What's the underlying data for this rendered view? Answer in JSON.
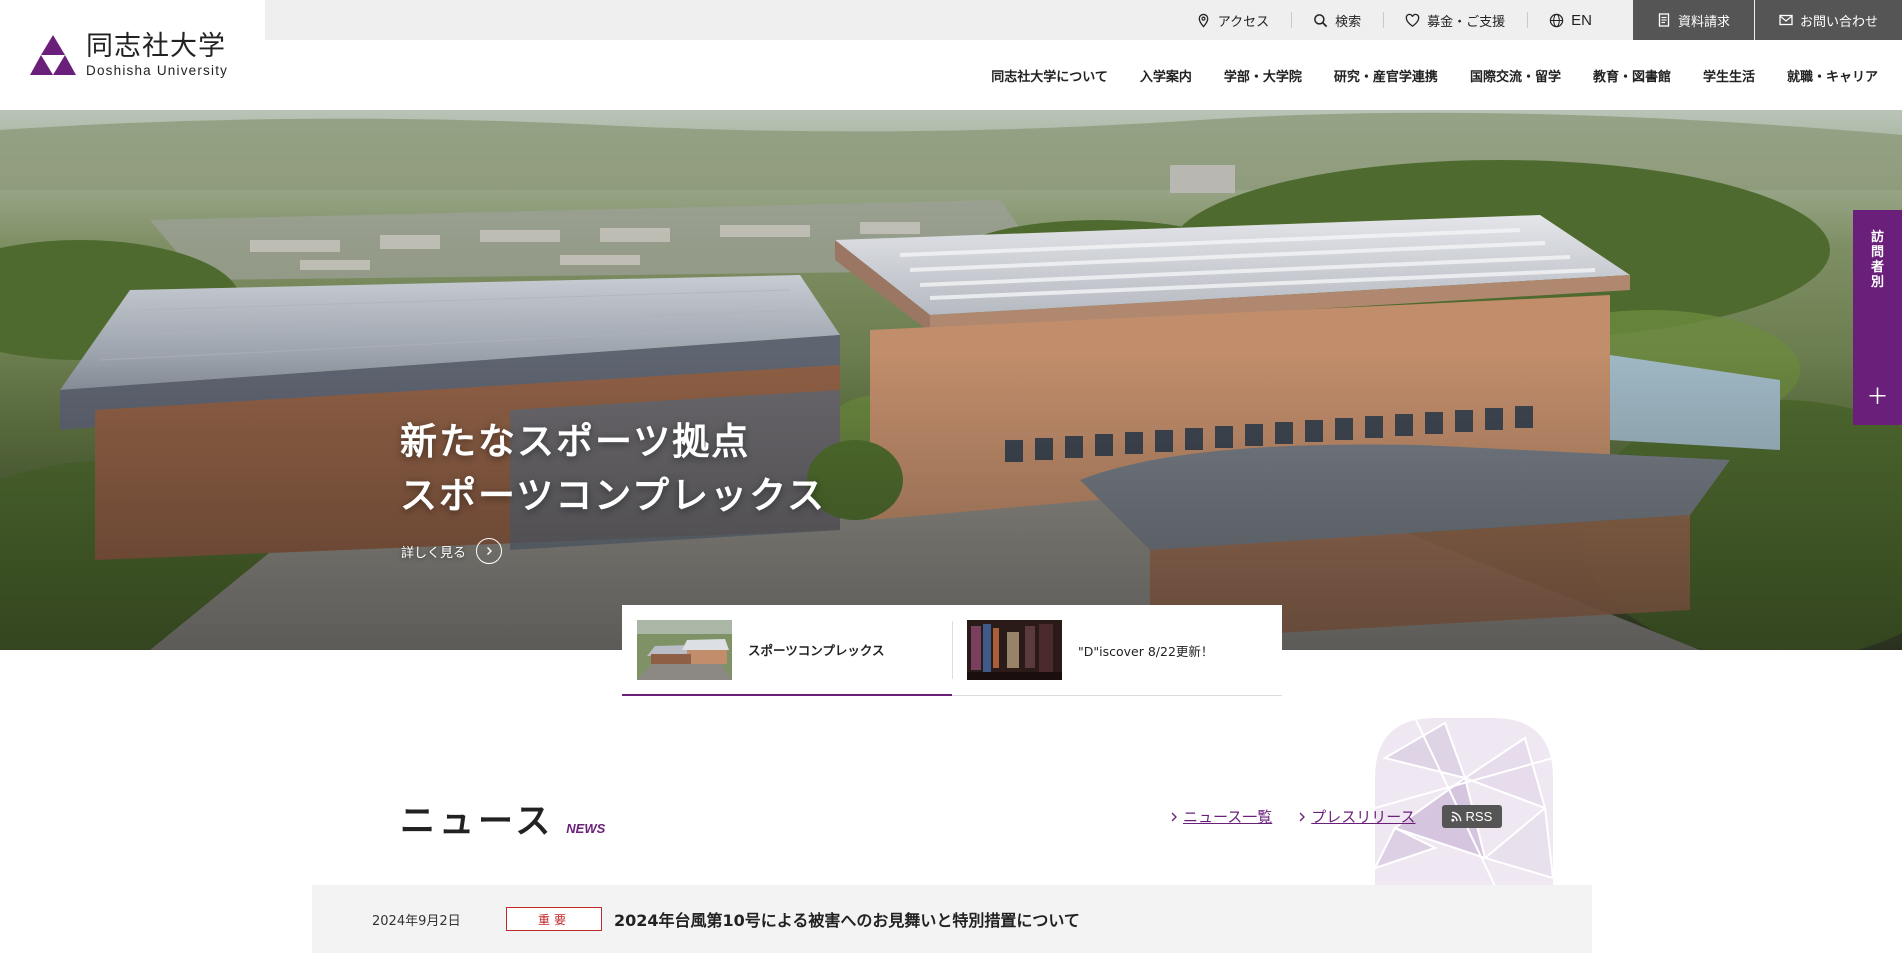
{
  "logo": {
    "jp": "同志社大学",
    "en": "Doshisha University",
    "brand_color": "#6a1f7a"
  },
  "utility": {
    "items": [
      {
        "label": "アクセス",
        "icon": "map-pin-icon"
      },
      {
        "label": "検索",
        "icon": "search-icon"
      },
      {
        "label": "募金・ご支援",
        "icon": "heart-icon"
      },
      {
        "label": "EN",
        "icon": "globe-icon"
      }
    ],
    "dark_buttons": [
      {
        "label": "資料請求",
        "icon": "document-icon"
      },
      {
        "label": "お問い合わせ",
        "icon": "mail-icon"
      }
    ]
  },
  "nav": [
    "同志社大学について",
    "入学案内",
    "学部・大学院",
    "研究・産官学連携",
    "国際交流・留学",
    "教育・図書館",
    "学生生活",
    "就職・キャリア"
  ],
  "hero": {
    "title_line1": "新たなスポーツ拠点",
    "title_line2": "スポーツコンプレックス",
    "more_label": "詳しく見る"
  },
  "slider": {
    "cards": [
      {
        "label": "スポーツコンプレックス",
        "active": true
      },
      {
        "label": "\"D\"iscover 8/22更新！",
        "active": false
      }
    ]
  },
  "visitor": {
    "label_chars": [
      "訪",
      "問",
      "者",
      "別"
    ],
    "plus": "＋"
  },
  "news": {
    "title": "ニュース",
    "subtitle": "NEWS",
    "links": [
      "ニュース一覧",
      "プレスリリース"
    ],
    "rss": "RSS",
    "items": [
      {
        "date": "2024年9月2日",
        "badge": "重要",
        "text": "2024年台風第10号による被害へのお見舞いと特別措置について"
      }
    ]
  },
  "colors": {
    "accent": "#6a1f7a",
    "badge_red": "#c0282b",
    "dark_button": "#555555",
    "utility_bg": "#efefef"
  }
}
